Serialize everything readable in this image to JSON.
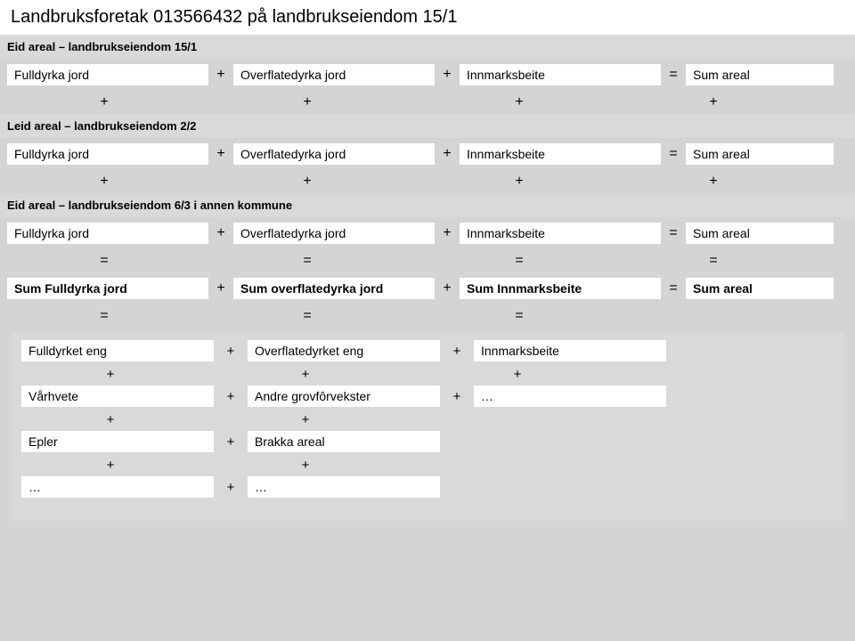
{
  "title": "Landbruksforetak 013566432 på landbrukseiendom 15/1",
  "rows": {
    "r1": {
      "header": "Eid areal – landbrukseiendom 15/1",
      "c1": "Fulldyrka jord",
      "c2": "Overflatedyrka jord",
      "c3": "Innmarksbeite",
      "c4": "Sum areal"
    },
    "r2": {
      "header": "Leid areal – landbrukseiendom 2/2",
      "c1": "Fulldyrka jord",
      "c2": "Overflatedyrka jord",
      "c3": "Innmarksbeite",
      "c4": "Sum areal"
    },
    "r3": {
      "header": "Eid areal – landbrukseiendom 6/3 i annen kommune",
      "c1": "Fulldyrka jord",
      "c2": "Overflatedyrka jord",
      "c3": "Innmarksbeite",
      "c4": "Sum areal"
    },
    "sum": {
      "c1": "Sum Fulldyrka jord",
      "c2": "Sum overflatedyrka jord",
      "c3": "Sum Innmarksbeite",
      "c4": "Sum areal"
    }
  },
  "crops": {
    "row1": {
      "c1": "Fulldyrket eng",
      "c2": "Overflatedyrket eng",
      "c3": "Innmarksbeite"
    },
    "row2": {
      "c1": "Vårhvete",
      "c2": "Andre grovfôrvekster",
      "c3": "…"
    },
    "row3": {
      "c1": "Epler",
      "c2": "Brakka areal"
    },
    "row4": {
      "c1": "…",
      "c2": "…"
    }
  },
  "ops": {
    "plus": "+",
    "eq": "="
  }
}
